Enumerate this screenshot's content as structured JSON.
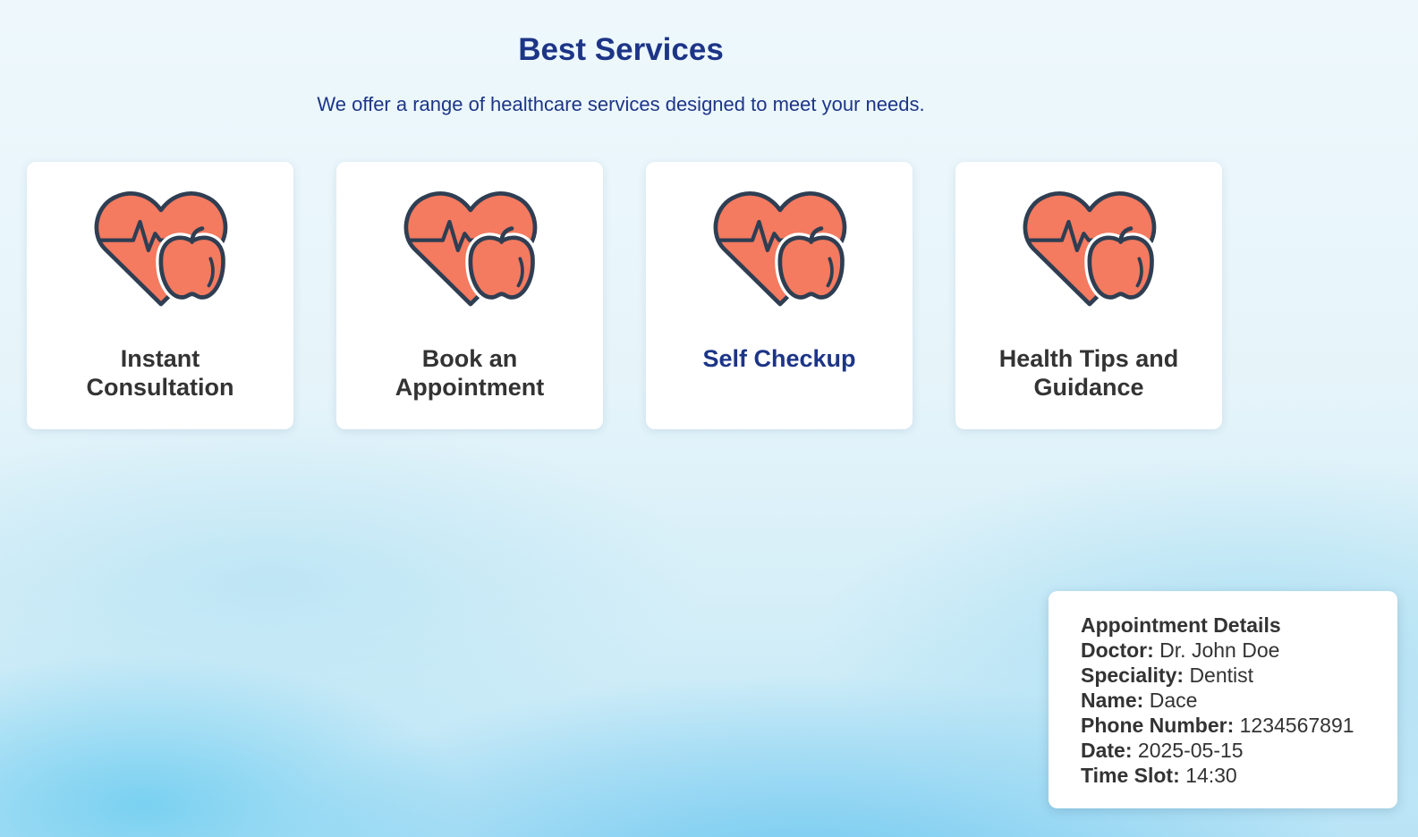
{
  "header": {
    "title": "Best Services",
    "subtitle": "We offer a range of healthcare services designed to meet your needs."
  },
  "services": [
    {
      "label": "Instant Consultation",
      "icon": "heart-apple-icon"
    },
    {
      "label": "Book an Appointment",
      "icon": "heart-apple-icon"
    },
    {
      "label": "Self Checkup",
      "icon": "heart-apple-icon",
      "highlighted": true
    },
    {
      "label": "Health Tips and Guidance",
      "icon": "heart-apple-icon"
    }
  ],
  "appointment": {
    "heading": "Appointment Details",
    "doctor_label": "Doctor:",
    "doctor": "Dr. John Doe",
    "speciality_label": "Speciality:",
    "speciality": "Dentist",
    "name_label": "Name:",
    "name": "Dace",
    "phone_label": "Phone Number:",
    "phone": "1234567891",
    "date_label": "Date:",
    "date": "2025-05-15",
    "time_label": "Time Slot:",
    "time": "14:30"
  },
  "colors": {
    "title": "#1d3587",
    "heart": "#f47a60",
    "outline": "#2f3e52"
  }
}
